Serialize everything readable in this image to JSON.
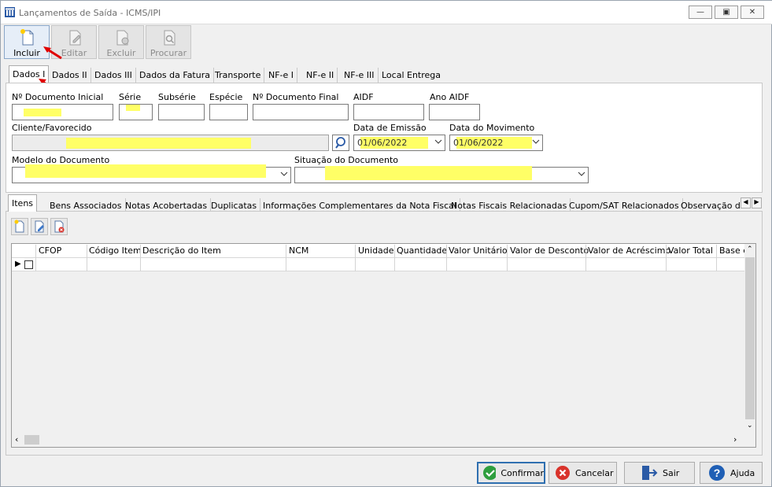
{
  "window": {
    "title": "Lançamentos de Saída - ICMS/IPI",
    "minimize": "—",
    "restore": "▣",
    "close": "✕"
  },
  "toolbar": {
    "include": "Incluir",
    "edit": "Editar",
    "delete": "Excluir",
    "search": "Procurar"
  },
  "tabs": [
    "Dados I",
    "Dados II",
    "Dados III",
    "Dados da Fatura",
    "Transporte",
    "NF-e I",
    "NF-e II",
    "NF-e III",
    "Local Entrega"
  ],
  "form": {
    "doc_inicial_label": "Nº Documento Inicial",
    "serie_label": "Série",
    "subserie_label": "Subsérie",
    "especie_label": "Espécie",
    "doc_final_label": "Nº Documento Final",
    "aidf_label": "AIDF",
    "ano_aidf_label": "Ano AIDF",
    "cliente_label": "Cliente/Favorecido",
    "data_emissao_label": "Data de Emissão",
    "data_emissao_value": "01/06/2022",
    "data_movimento_label": "Data do Movimento",
    "data_movimento_value": "01/06/2022",
    "modelo_label": "Modelo do Documento",
    "situacao_label": "Situação do Documento"
  },
  "subtabs": [
    "Itens",
    "Bens Associados",
    "Notas Acobertadas",
    "Duplicatas",
    "Informações Complementares da Nota Fiscal",
    "Notas Fiscais Relacionadas",
    "Cupom/SAT Relacionados",
    "Observação d"
  ],
  "grid": {
    "columns": [
      "CFOP",
      "Código Item",
      "Descrição do Item",
      "NCM",
      "Unidade",
      "Quantidade",
      "Valor Unitário",
      "Valor de Desconto",
      "Valor de Acréscimo",
      "Valor Total",
      "Base c"
    ]
  },
  "footer": {
    "confirm": "Confirmar",
    "cancel": "Cancelar",
    "exit": "Sair",
    "help": "Ajuda"
  },
  "colors": {
    "highlight": "#ffff66",
    "confirm_green": "#2e9e3e",
    "cancel_red": "#d9332b",
    "help_blue": "#1f5fb5",
    "arrow_red": "#e00000"
  }
}
